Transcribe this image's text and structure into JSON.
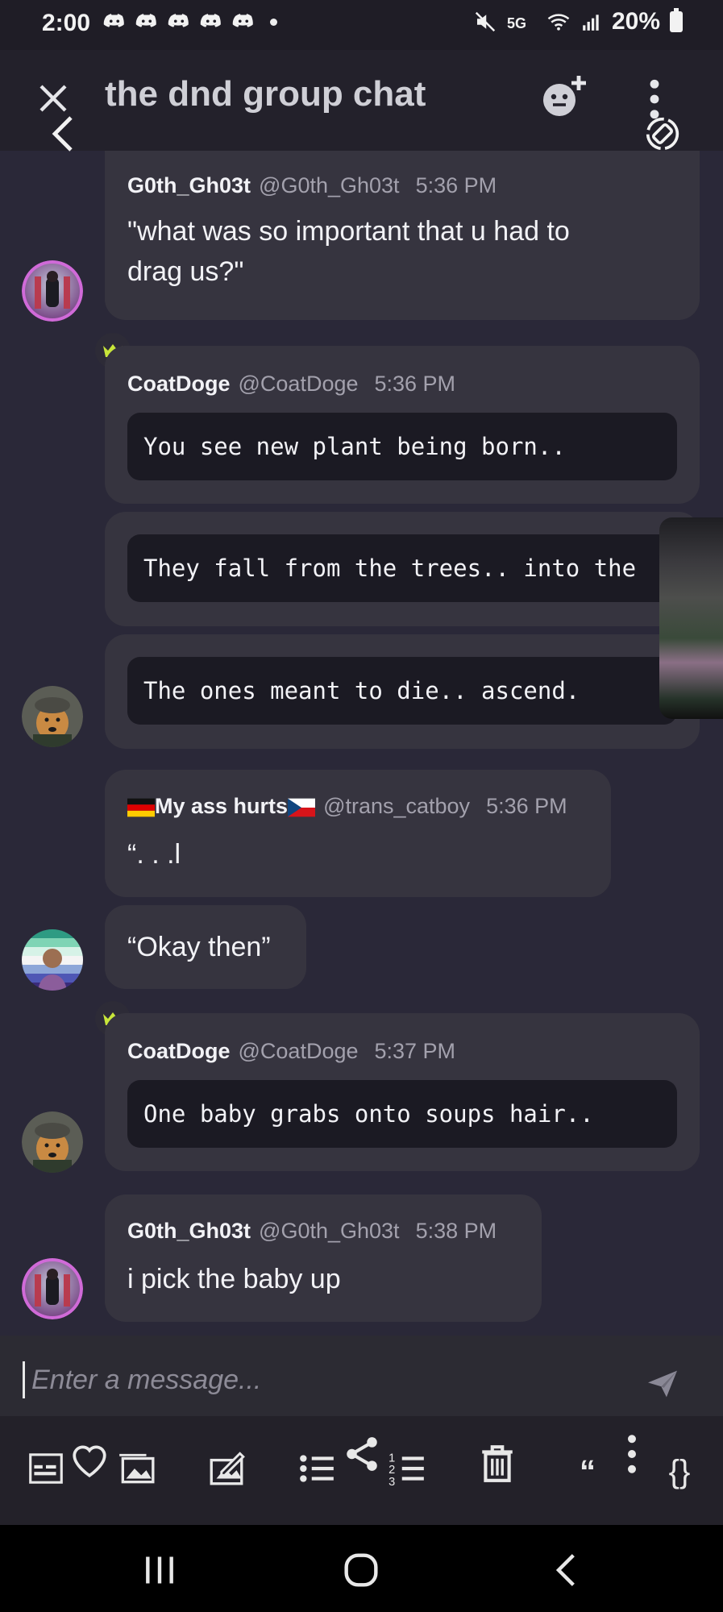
{
  "status": {
    "time": "2:00",
    "battery": "20%"
  },
  "header": {
    "title": "the dnd group chat",
    "close_icon": "close-icon",
    "back_icon": "chevron-left-icon",
    "add_member_icon": "add-member-icon",
    "menu_icon": "more-vertical-icon"
  },
  "messages": [
    {
      "author": "G0th_Gh03t",
      "handle": "@G0th_Gh03t",
      "time": "5:36 PM",
      "text_line1": "\"what was so important that u had to",
      "text_line2": "drag us?\""
    },
    {
      "author": "CoatDoge",
      "handle": "@CoatDoge",
      "time": "5:36 PM",
      "code": "You see new plant being born.."
    },
    {
      "code": "They fall from the trees.. into the"
    },
    {
      "code": "The ones meant to die.. ascend."
    },
    {
      "author": "My ass hurts",
      "handle": "@trans_catboy",
      "time": "5:36 PM",
      "text": "“. . .l"
    },
    {
      "text": "“Okay then”"
    },
    {
      "author": "CoatDoge",
      "handle": "@CoatDoge",
      "time": "5:37 PM",
      "code": "One baby grabs onto soups hair.."
    },
    {
      "author": "G0th_Gh03t",
      "handle": "@G0th_Gh03t",
      "time": "5:38 PM",
      "text": "i pick the baby up"
    }
  ],
  "input": {
    "placeholder": "Enter a message..."
  },
  "toolbar": {
    "tools": [
      "spoiler-icon",
      "heart-icon",
      "image-icon",
      "edit-image-icon",
      "bullet-list-icon",
      "share-icon",
      "numbered-list-icon",
      "delete-icon",
      "quote-icon",
      "more-icon",
      "code-icon"
    ],
    "quote_glyph": "“",
    "code_glyph": "{}"
  },
  "colors": {
    "background": "#2a2838",
    "bubble": "#36343f",
    "code_bg": "#1b1a23",
    "crown": "#c8e63a"
  }
}
